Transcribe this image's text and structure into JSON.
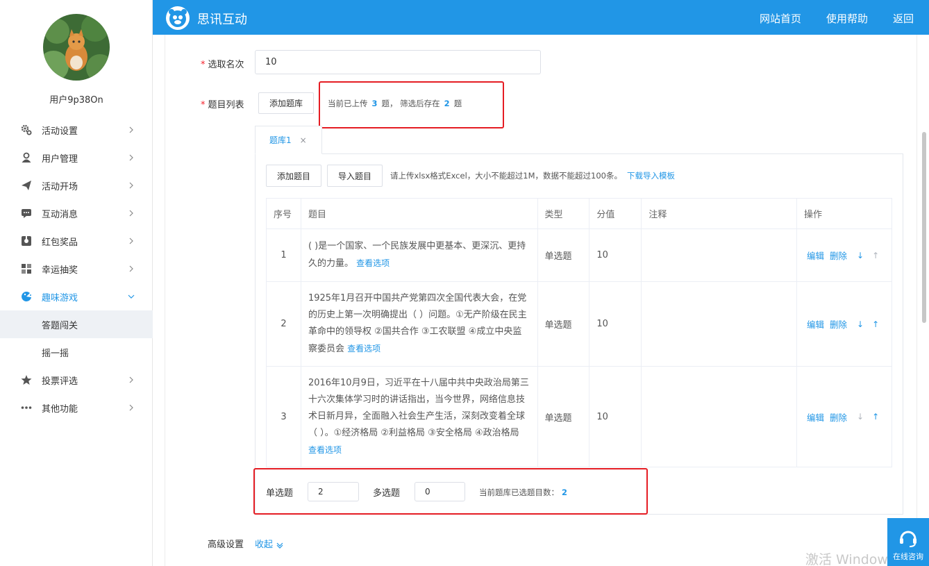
{
  "header": {
    "brand": "思讯互动",
    "nav": [
      "网站首页",
      "使用帮助",
      "返回"
    ]
  },
  "sidebar": {
    "username": "用户9p38On",
    "items": [
      {
        "label": "活动设置",
        "icon": "gear-icon"
      },
      {
        "label": "用户管理",
        "icon": "user-icon"
      },
      {
        "label": "活动开场",
        "icon": "paper-plane-icon"
      },
      {
        "label": "互动消息",
        "icon": "message-icon"
      },
      {
        "label": "红包奖品",
        "icon": "gift-icon"
      },
      {
        "label": "幸运抽奖",
        "icon": "lottery-icon"
      },
      {
        "label": "趣味游戏",
        "icon": "game-icon"
      },
      {
        "label": "投票评选",
        "icon": "star-icon"
      },
      {
        "label": "其他功能",
        "icon": "more-icon"
      }
    ],
    "sub_items": [
      "答题闯关",
      "摇一摇"
    ]
  },
  "form": {
    "rank_label": "选取名次",
    "rank_value": "10",
    "list_label": "题目列表",
    "add_bank_button": "添加题库",
    "upload_hint_prefix": "当前已上传",
    "uploaded_count": "3",
    "upload_hint_mid": "题， 筛选后存在",
    "filtered_count": "2",
    "upload_hint_suffix": "题",
    "tab_label": "题库1",
    "tab_close": "×",
    "add_question_button": "添加题目",
    "import_question_button": "导入题目",
    "import_hint": "请上传xlsx格式Excel，大小不能超过1M，数据不能超过100条。",
    "download_template": "下载导入模板",
    "single_label": "单选题",
    "single_value": "2",
    "multi_label": "多选题",
    "multi_value": "0",
    "selected_label": "当前题库已选题目数：",
    "selected_count": "2",
    "advanced_label": "高级设置",
    "collapse_link": "收起"
  },
  "table": {
    "headers": [
      "序号",
      "题目",
      "类型",
      "分值",
      "注释",
      "操作"
    ],
    "view_options": "查看选项",
    "edit": "编辑",
    "delete": "删除",
    "rows": [
      {
        "index": "1",
        "question": "( )是一个国家、一个民族发展中更基本、更深沉、更持久的力量。",
        "type": "单选题",
        "score": "10",
        "note": ""
      },
      {
        "index": "2",
        "question": "1925年1月召开中国共产党第四次全国代表大会，在党的历史上第一次明确提出（ ）问题。①无产阶级在民主革命中的领导权 ②国共合作 ③工农联盟 ④成立中央监察委员会",
        "type": "单选题",
        "score": "10",
        "note": ""
      },
      {
        "index": "3",
        "question": "2016年10月9日，习近平在十八届中共中央政治局第三十六次集体学习时的讲话指出，当今世界，网络信息技术日新月异，全面融入社会生产生活，深刻改变着全球（ ）。①经济格局 ②利益格局 ③安全格局 ④政治格局",
        "type": "单选题",
        "score": "10",
        "note": ""
      }
    ]
  },
  "consult": {
    "label": "在线咨询"
  },
  "watermark": "激活 Window",
  "colors": {
    "primary": "#2196e6",
    "highlight_box": "#e51c23"
  }
}
